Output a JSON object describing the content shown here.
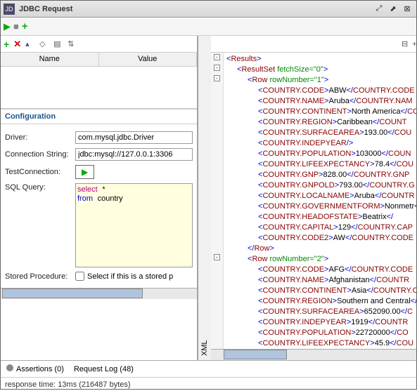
{
  "window": {
    "title": "JDBC Request"
  },
  "table": {
    "headers": [
      "Name",
      "Value"
    ]
  },
  "config": {
    "header": "Configuration",
    "driverLabel": "Driver:",
    "driverValue": "com.mysql.jdbc.Driver",
    "connLabel": "Connection String:",
    "connValue": "jdbc:mysql://127.0.0.1:3306",
    "testLabel": "TestConnection:",
    "sqlLabel": "SQL Query:",
    "sqlSelect": "select",
    "sqlStar": "*",
    "sqlFrom": "from",
    "sqlTable": "country",
    "storedLabel": "Stored Procedure:",
    "storedCheck": "Select if this is a stored p"
  },
  "xmlTab": "XML",
  "footer": {
    "assertions": "Assertions (0)",
    "requestLog": "Request Log (48)",
    "status": "response time: 13ms (216487 bytes)"
  },
  "chart_data": {
    "type": "table",
    "root": "Results",
    "resultset_attr": "fetchSize=\"0\"",
    "rows": [
      {
        "rowNumber": "1",
        "truncated": false,
        "fields": [
          {
            "tag": "COUNTRY.CODE",
            "value": "ABW",
            "close": "COUNTRY.CODE",
            "cut": true
          },
          {
            "tag": "COUNTRY.NAME",
            "value": "Aruba",
            "close": "COUNTRY.NAM",
            "cut": true
          },
          {
            "tag": "COUNTRY.CONTINENT",
            "value": "North America",
            "close": "CO",
            "cut": true
          },
          {
            "tag": "COUNTRY.REGION",
            "value": "Caribbean",
            "close": "COUNT",
            "cut": true
          },
          {
            "tag": "COUNTRY.SURFACEAREA",
            "value": "193.00",
            "close": "COU",
            "cut": true
          },
          {
            "tag": "COUNTRY.INDEPYEAR",
            "value": "",
            "close": "",
            "selfclose": true
          },
          {
            "tag": "COUNTRY.POPULATION",
            "value": "103000",
            "close": "COUN",
            "cut": true
          },
          {
            "tag": "COUNTRY.LIFEEXPECTANCY",
            "value": "78.4",
            "close": "COU",
            "cut": true
          },
          {
            "tag": "COUNTRY.GNP",
            "value": "828.00",
            "close": "COUNTRY.GNP",
            "cut": true
          },
          {
            "tag": "COUNTRY.GNPOLD",
            "value": "793.00",
            "close": "COUNTRY.G",
            "cut": true
          },
          {
            "tag": "COUNTRY.LOCALNAME",
            "value": "Aruba",
            "close": "COUNTR",
            "cut": true
          },
          {
            "tag": "COUNTRY.GOVERNMENTFORM",
            "value": "Nonmetr",
            "close": "",
            "cut": true
          },
          {
            "tag": "COUNTRY.HEADOFSTATE",
            "value": "Beatrix",
            "close": "",
            "cut": true
          },
          {
            "tag": "COUNTRY.CAPITAL",
            "value": "129",
            "close": "COUNTRY.CAP",
            "cut": true
          },
          {
            "tag": "COUNTRY.CODE2",
            "value": "AW",
            "close": "COUNTRY.CODE",
            "cut": true
          }
        ]
      },
      {
        "rowNumber": "2",
        "truncated": true,
        "fields": [
          {
            "tag": "COUNTRY.CODE",
            "value": "AFG",
            "close": "COUNTRY.CODE",
            "cut": true
          },
          {
            "tag": "COUNTRY.NAME",
            "value": "Afghanistan",
            "close": "COUNTR",
            "cut": true
          },
          {
            "tag": "COUNTRY.CONTINENT",
            "value": "Asia",
            "close": "COUNTRY.C",
            "cut": true
          },
          {
            "tag": "COUNTRY.REGION",
            "value": "Southern and Central",
            "close": "",
            "cut": true
          },
          {
            "tag": "COUNTRY.SURFACEAREA",
            "value": "652090.00",
            "close": "C",
            "cut": true
          },
          {
            "tag": "COUNTRY.INDEPYEAR",
            "value": "1919",
            "close": "COUNTR",
            "cut": true
          },
          {
            "tag": "COUNTRY.POPULATION",
            "value": "22720000",
            "close": "CO",
            "cut": true
          },
          {
            "tag": "COUNTRY.LIFEEXPECTANCY",
            "value": "45.9",
            "close": "COU",
            "cut": true
          }
        ]
      }
    ]
  }
}
